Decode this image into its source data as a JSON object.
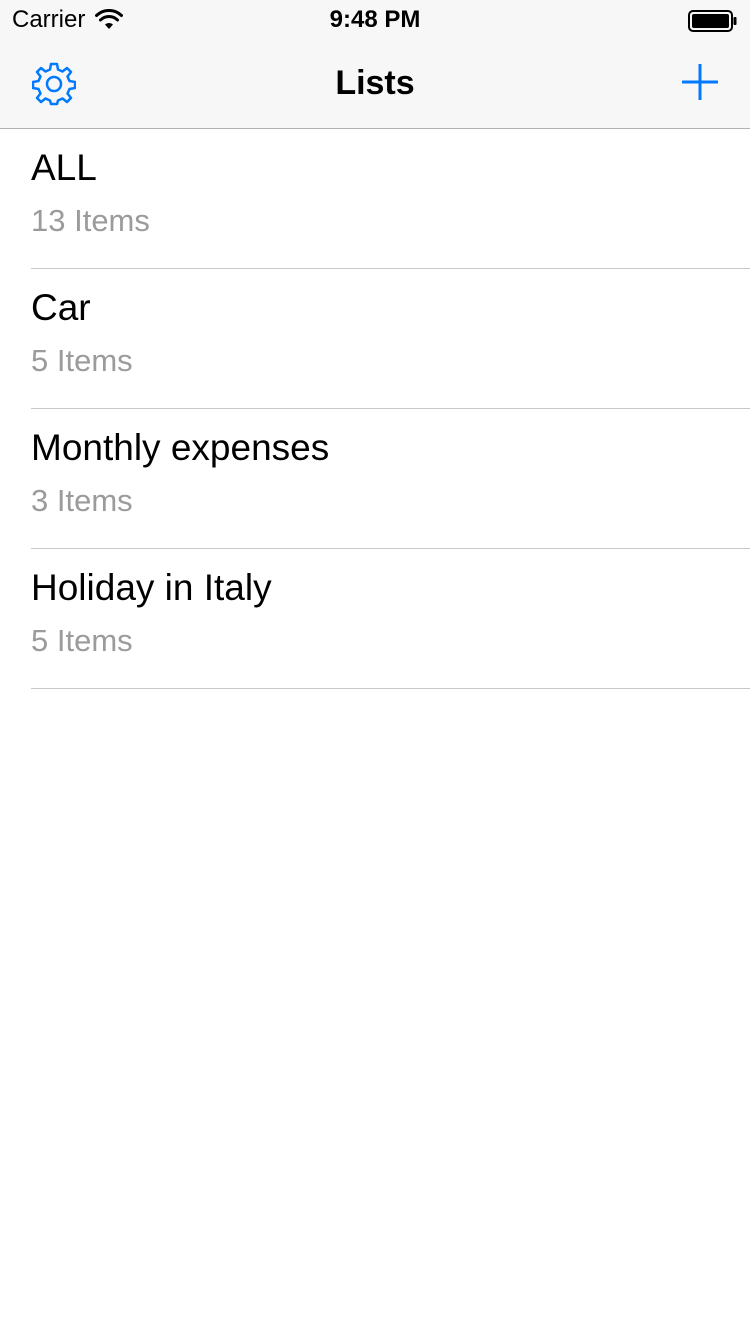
{
  "status_bar": {
    "carrier": "Carrier",
    "time": "9:48 PM"
  },
  "nav": {
    "title": "Lists",
    "left_icon": "gear-icon",
    "right_icon": "plus-icon",
    "accent_color": "#007aff"
  },
  "lists": [
    {
      "title": "ALL",
      "count": "13 Items"
    },
    {
      "title": "Car",
      "count": "5 Items"
    },
    {
      "title": "Monthly expenses",
      "count": "3 Items"
    },
    {
      "title": "Holiday in Italy",
      "count": "5 Items"
    }
  ]
}
